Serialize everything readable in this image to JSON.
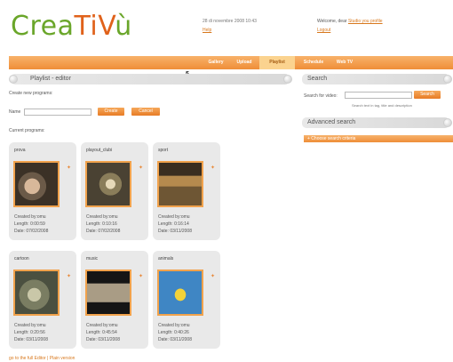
{
  "header": {
    "logo": {
      "part1": "Crea",
      "part2": "TiV",
      "part3": "ù"
    },
    "date": "28 di novembre 2008 10:43",
    "date_link": "Help",
    "welcome_prefix": "Welcome, dear",
    "user": "Studio you profile",
    "logout": "Logout"
  },
  "nav": {
    "items": [
      {
        "label": "Gallery"
      },
      {
        "label": "Upload"
      },
      {
        "label": "Playlist"
      },
      {
        "label": "Schedule"
      },
      {
        "label": "Web TV"
      }
    ],
    "active_index": 2
  },
  "editor": {
    "title": "Playlist - editor",
    "create_label": "Create new programs:",
    "name_label": "Name",
    "create_button": "Create",
    "cancel_button": "Cancel",
    "current_label": "Current programs:"
  },
  "programs": [
    {
      "title": "prova",
      "created": "Created by:omu",
      "length": "Length: 0:00:59",
      "date": "Date: 07/02/2008"
    },
    {
      "title": "playout_clubi",
      "created": "Created by:omu",
      "length": "Length: 0:10:16",
      "date": "Date: 07/02/2008"
    },
    {
      "title": "sport",
      "created": "Created by:omu",
      "length": "Length: 0:16:14",
      "date": "Date: 03/11/2008"
    },
    {
      "title": "cartoon",
      "created": "Created by:omu",
      "length": "Length: 0:20:56",
      "date": "Date: 03/11/2008"
    },
    {
      "title": "music",
      "created": "Created by:omu",
      "length": "Length: 0:45:54",
      "date": "Date: 03/11/2008"
    },
    {
      "title": "animals",
      "created": "Created by:omu",
      "length": "Length: 0:40:26",
      "date": "Date: 03/11/2008"
    }
  ],
  "search": {
    "title": "Search",
    "label": "Search for video:",
    "placeholder": "",
    "button": "Search",
    "help": "Search text in tag, title and description"
  },
  "advanced": {
    "title": "Advanced search",
    "bar_label": "+ Choose search criteria"
  },
  "footer": {
    "text": "go to the full Editor | Plain version"
  },
  "colors": {
    "orange": "#ef8e38",
    "green": "#6aa62a",
    "panel": "#e9e9e9"
  }
}
